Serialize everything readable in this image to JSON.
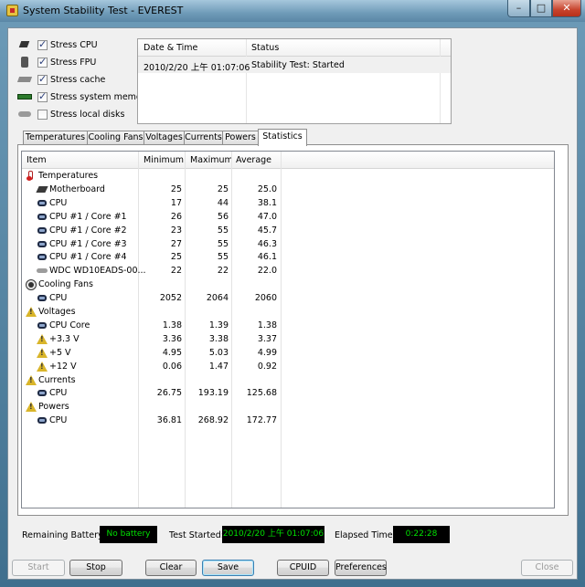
{
  "window": {
    "title": "System Stability Test - EVEREST",
    "min_glyph": "–",
    "max_glyph": "□",
    "close_glyph": "✕"
  },
  "stress_options": [
    {
      "label": "Stress CPU",
      "checked": true,
      "icon": "cpu-icon"
    },
    {
      "label": "Stress FPU",
      "checked": true,
      "icon": "fpu-icon"
    },
    {
      "label": "Stress cache",
      "checked": true,
      "icon": "cache-icon"
    },
    {
      "label": "Stress system memory",
      "checked": true,
      "icon": "memory-icon"
    },
    {
      "label": "Stress local disks",
      "checked": false,
      "icon": "disk-icon"
    }
  ],
  "log": {
    "headers": {
      "datetime": "Date & Time",
      "status": "Status"
    },
    "rows": [
      {
        "datetime": "2010/2/20 上午 01:07:06",
        "status": "Stability Test: Started"
      }
    ]
  },
  "tabs": [
    "Temperatures",
    "Cooling Fans",
    "Voltages",
    "Currents",
    "Powers",
    "Statistics"
  ],
  "active_tab": "Statistics",
  "stats": {
    "headers": {
      "item": "Item",
      "min": "Minimum",
      "max": "Maximum",
      "avg": "Average"
    },
    "rows": [
      {
        "type": "group",
        "icon": "thermometer-icon",
        "item": "Temperatures",
        "min": "",
        "max": "",
        "avg": ""
      },
      {
        "type": "item",
        "icon": "motherboard-icon",
        "item": "Motherboard",
        "min": "25",
        "max": "25",
        "avg": "25.0"
      },
      {
        "type": "item",
        "icon": "cpu-icon",
        "item": "CPU",
        "min": "17",
        "max": "44",
        "avg": "38.1"
      },
      {
        "type": "item",
        "icon": "cpu-icon",
        "item": "CPU #1 / Core #1",
        "min": "26",
        "max": "56",
        "avg": "47.0"
      },
      {
        "type": "item",
        "icon": "cpu-icon",
        "item": "CPU #1 / Core #2",
        "min": "23",
        "max": "55",
        "avg": "45.7"
      },
      {
        "type": "item",
        "icon": "cpu-icon",
        "item": "CPU #1 / Core #3",
        "min": "27",
        "max": "55",
        "avg": "46.3"
      },
      {
        "type": "item",
        "icon": "cpu-icon",
        "item": "CPU #1 / Core #4",
        "min": "25",
        "max": "55",
        "avg": "46.1"
      },
      {
        "type": "item",
        "icon": "hard-disk-icon",
        "item": "WDC WD10EADS-00...",
        "min": "22",
        "max": "22",
        "avg": "22.0"
      },
      {
        "type": "group",
        "icon": "fan-icon",
        "item": "Cooling Fans",
        "min": "",
        "max": "",
        "avg": ""
      },
      {
        "type": "item",
        "icon": "cpu-icon",
        "item": "CPU",
        "min": "2052",
        "max": "2064",
        "avg": "2060"
      },
      {
        "type": "group",
        "icon": "warning-icon",
        "item": "Voltages",
        "min": "",
        "max": "",
        "avg": ""
      },
      {
        "type": "item",
        "icon": "cpu-icon",
        "item": "CPU Core",
        "min": "1.38",
        "max": "1.39",
        "avg": "1.38"
      },
      {
        "type": "item",
        "icon": "warning-icon",
        "item": "+3.3 V",
        "min": "3.36",
        "max": "3.38",
        "avg": "3.37"
      },
      {
        "type": "item",
        "icon": "warning-icon",
        "item": "+5 V",
        "min": "4.95",
        "max": "5.03",
        "avg": "4.99"
      },
      {
        "type": "item",
        "icon": "warning-icon",
        "item": "+12 V",
        "min": "0.06",
        "max": "1.47",
        "avg": "0.92"
      },
      {
        "type": "group",
        "icon": "warning-icon",
        "item": "Currents",
        "min": "",
        "max": "",
        "avg": ""
      },
      {
        "type": "item",
        "icon": "cpu-icon",
        "item": "CPU",
        "min": "26.75",
        "max": "193.19",
        "avg": "125.68"
      },
      {
        "type": "group",
        "icon": "warning-icon",
        "item": "Powers",
        "min": "",
        "max": "",
        "avg": ""
      },
      {
        "type": "item",
        "icon": "cpu-icon",
        "item": "CPU",
        "min": "36.81",
        "max": "268.92",
        "avg": "172.77"
      }
    ]
  },
  "status": {
    "battery_label": "Remaining Battery:",
    "battery_value": "No battery",
    "started_label": "Test Started:",
    "started_value": "2010/2/20 上午 01:07:06",
    "elapsed_label": "Elapsed Time:",
    "elapsed_value": "0:22:28",
    "display_color": "#00e100"
  },
  "buttons": {
    "start": {
      "label": "Start",
      "enabled": false
    },
    "stop": {
      "label": "Stop",
      "enabled": true
    },
    "clear": {
      "label": "Clear",
      "enabled": true
    },
    "save": {
      "label": "Save",
      "enabled": true
    },
    "cpuid": {
      "label": "CPUID",
      "enabled": true
    },
    "preferences": {
      "label": "Preferences",
      "enabled": true
    },
    "close": {
      "label": "Close",
      "enabled": false
    }
  }
}
